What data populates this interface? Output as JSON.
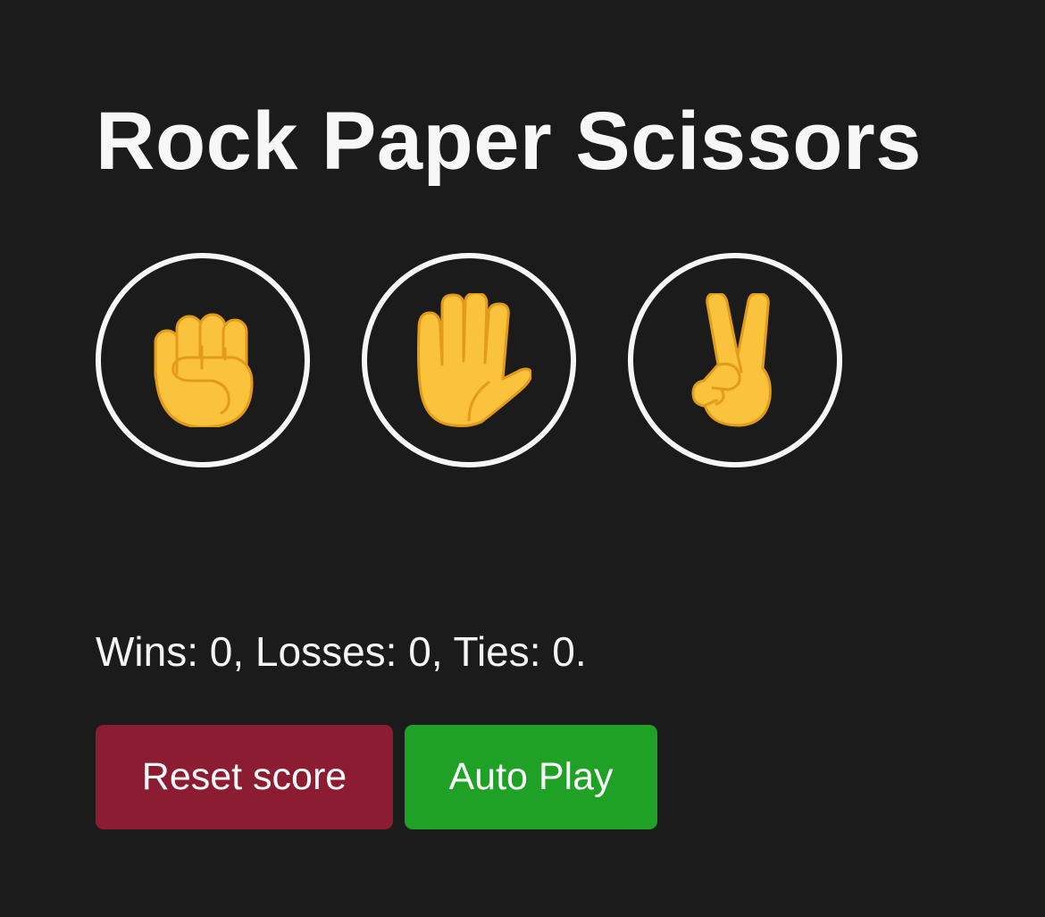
{
  "title": "Rock Paper Scissors",
  "choices": [
    {
      "name": "rock",
      "icon": "raised-fist-icon"
    },
    {
      "name": "paper",
      "icon": "raised-hand-icon"
    },
    {
      "name": "scissors",
      "icon": "victory-hand-icon"
    }
  ],
  "score": {
    "text": "Wins: 0, Losses: 0, Ties: 0."
  },
  "buttons": {
    "reset_label": "Reset score",
    "auto_play_label": "Auto Play"
  },
  "colors": {
    "background": "#1b1b1b",
    "text": "#f5f5f5",
    "reset": "#8b1c31",
    "auto_play": "#1fa126",
    "emoji_skin": "#fbc23b",
    "emoji_outline": "#e39b1b"
  }
}
